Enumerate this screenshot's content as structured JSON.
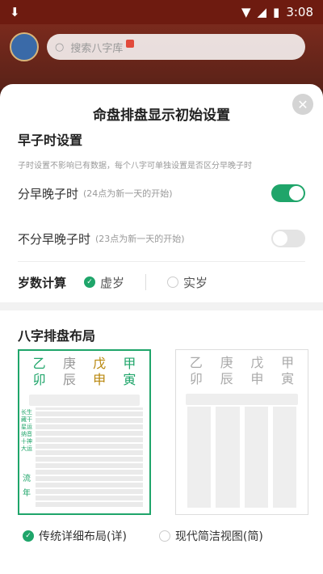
{
  "statusbar": {
    "time": "3:08",
    "download_icon": "download-icon"
  },
  "search": {
    "placeholder": "搜索八字库"
  },
  "sheet": {
    "title": "命盘排盘显示初始设置",
    "zishi": {
      "section_title": "早子时设置",
      "hint": "子时设置不影响已有数据，每个八字可单独设置是否区分早晚子时",
      "opt1_label": "分早晚子时",
      "opt1_sub": "(24点为新一天的开始)",
      "opt1_on": true,
      "opt2_label": "不分早晚子时",
      "opt2_sub": "(23点为新一天的开始)",
      "opt2_on": false
    },
    "age": {
      "label": "岁数计算",
      "opt1": "虚岁",
      "opt2": "实岁",
      "selected": "虚岁"
    },
    "layout": {
      "section_title": "八字排盘布局",
      "card1": {
        "pillars": [
          {
            "top": "乙",
            "bottom": "卯",
            "color": "#1fa56a"
          },
          {
            "top": "庚",
            "bottom": "辰",
            "color": "#999999"
          },
          {
            "top": "戊",
            "bottom": "申",
            "color": "#b8860b"
          },
          {
            "top": "甲",
            "bottom": "寅",
            "color": "#1fa56a"
          }
        ],
        "side_small": "长生 藏干 星运 纳音 十神 大运",
        "side_big": "流年"
      },
      "card2": {
        "pillars": [
          {
            "top": "乙",
            "bottom": "卯"
          },
          {
            "top": "庚",
            "bottom": "辰"
          },
          {
            "top": "戊",
            "bottom": "申"
          },
          {
            "top": "甲",
            "bottom": "寅"
          }
        ]
      },
      "opt1": "传统详细布局(详)",
      "opt2": "现代简洁视图(简)",
      "selected": "传统详细布局(详)"
    }
  },
  "colors": {
    "accent": "#1fa56a"
  }
}
